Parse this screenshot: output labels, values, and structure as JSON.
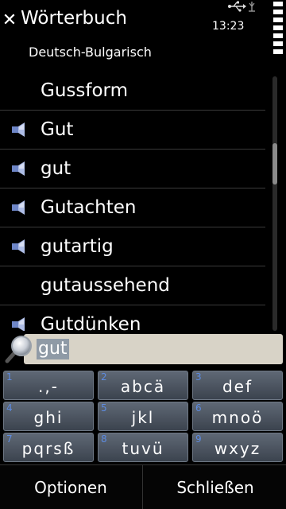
{
  "header": {
    "title": "Wörterbuch",
    "subtitle": "Deutsch-Bulgarisch",
    "close_icon": "close-icon",
    "time": "13:23",
    "status_icons": [
      "usb-icon",
      "antenna-icon",
      "battery-icon"
    ]
  },
  "list": {
    "items": [
      {
        "word": "Gussform",
        "has_audio": false
      },
      {
        "word": "Gut",
        "has_audio": true
      },
      {
        "word": "gut",
        "has_audio": true
      },
      {
        "word": "Gutachten",
        "has_audio": true
      },
      {
        "word": "gutartig",
        "has_audio": true
      },
      {
        "word": "gutaussehend",
        "has_audio": false
      },
      {
        "word": "Gutdünken",
        "has_audio": true
      }
    ]
  },
  "search": {
    "value": "gut",
    "icon": "magnifier-icon"
  },
  "keypad": {
    "keys": [
      {
        "num": "1",
        "letters": ".,-"
      },
      {
        "num": "2",
        "letters": "abcä"
      },
      {
        "num": "3",
        "letters": "def"
      },
      {
        "num": "4",
        "letters": "ghi"
      },
      {
        "num": "5",
        "letters": "jkl"
      },
      {
        "num": "6",
        "letters": "mnoö"
      },
      {
        "num": "7",
        "letters": "pqrsß"
      },
      {
        "num": "8",
        "letters": "tuvü"
      },
      {
        "num": "9",
        "letters": "wxyz"
      }
    ]
  },
  "softkeys": {
    "left": "Optionen",
    "right": "Schließen"
  },
  "colors": {
    "background": "#000000",
    "key_number": "#5d8be0",
    "search_box": "#d8d3c7",
    "selection_highlight": "#8f9aa6"
  }
}
